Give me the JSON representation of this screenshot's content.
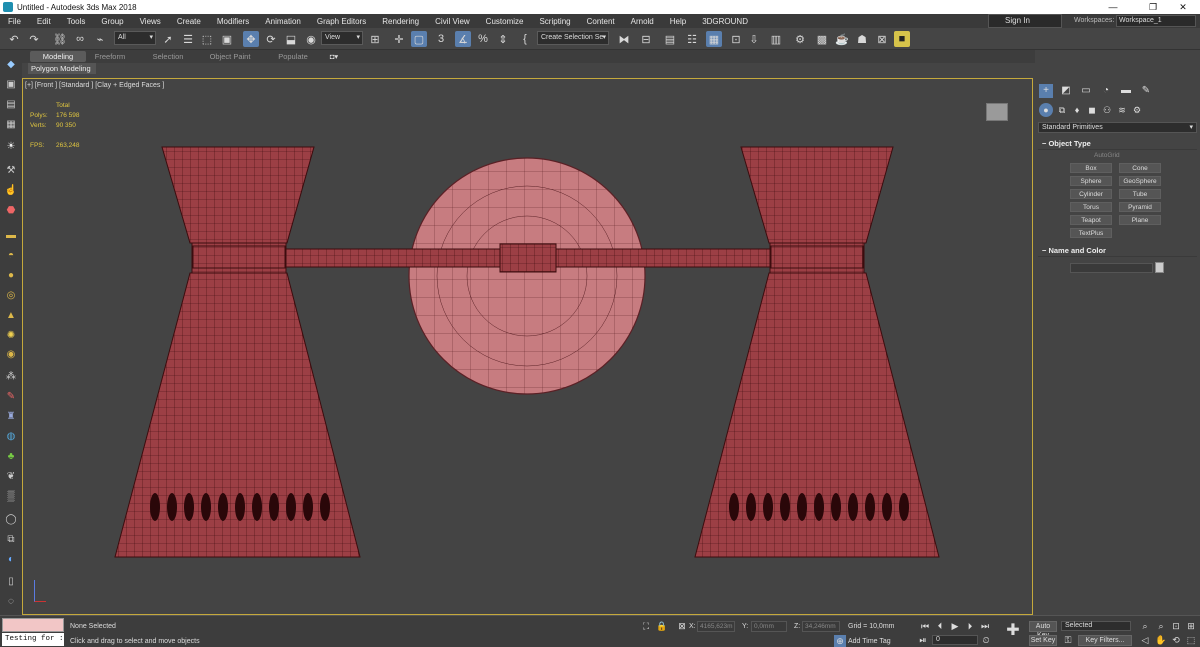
{
  "window": {
    "title": "Untitled - Autodesk 3ds Max 2018",
    "minimize": "—",
    "maximize": "❐",
    "close": "✕"
  },
  "menu": [
    "File",
    "Edit",
    "Tools",
    "Group",
    "Views",
    "Create",
    "Modifiers",
    "Animation",
    "Graph Editors",
    "Rendering",
    "Civil View",
    "Customize",
    "Scripting",
    "Content",
    "Arnold",
    "Help",
    "3DGROUND"
  ],
  "account": {
    "signin": "Sign In",
    "workspaces_label": "Workspaces:",
    "workspace": "Workspace_1"
  },
  "toolbar": {
    "filter": "All",
    "refcoord": "View",
    "selection_set": "Create Selection Se",
    "snap_label": "3",
    "angle_snap": "%"
  },
  "ribbon": {
    "tabs": [
      "Modeling",
      "Freeform",
      "Selection",
      "Object Paint",
      "Populate"
    ],
    "panel": "Polygon Modeling"
  },
  "viewport": {
    "label": "[+] [Front ] [Standard ] [Clay + Edged Faces ]",
    "stats": {
      "total_label": "Total",
      "polys_label": "Polys:",
      "polys": "176 598",
      "verts_label": "Verts:",
      "verts": "90 350",
      "fps_label": "FPS:",
      "fps": "263,248"
    },
    "colors": {
      "mesh_fill": "#9c3f45",
      "wire": "#3c0c0e",
      "disc_fill": "#c77c80",
      "background": "#444444"
    }
  },
  "command_panel": {
    "primitives": "Standard Primitives",
    "object_type": "Object Type",
    "autogrid": "AutoGrid",
    "buttons": [
      "Box",
      "Cone",
      "Sphere",
      "GeoSphere",
      "Cylinder",
      "Tube",
      "Torus",
      "Pyramid",
      "Teapot",
      "Plane",
      "TextPlus"
    ],
    "name_and_color": "Name and Color"
  },
  "status": {
    "script": "Testing for :",
    "selection": "None Selected",
    "prompt": "Click and drag to select and move objects",
    "x_label": "X:",
    "x": "4165,623m",
    "y_label": "Y:",
    "y": "0,0mm",
    "z_label": "Z:",
    "z": "34,246mm",
    "grid": "Grid = 10,0mm",
    "add_time_tag": "Add Time Tag",
    "auto_key": "Auto Key",
    "set_key": "Set Key",
    "key_mode": "Selected",
    "key_filters": "Key Filters...",
    "frame": "0"
  }
}
